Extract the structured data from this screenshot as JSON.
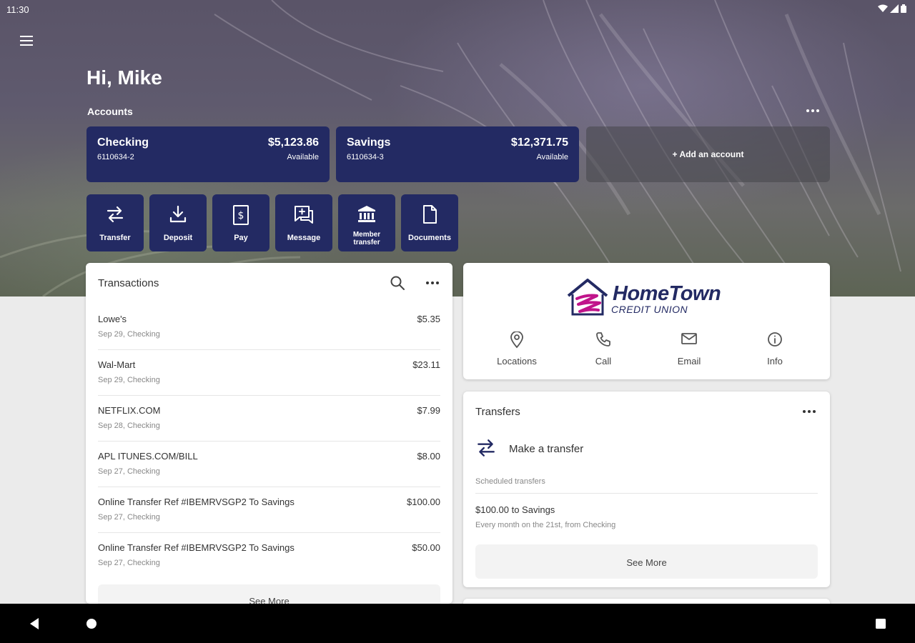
{
  "status_bar": {
    "time": "11:30"
  },
  "greeting": "Hi, Mike",
  "accounts": {
    "label": "Accounts",
    "items": [
      {
        "name": "Checking",
        "number": "6110634-2",
        "balance": "$5,123.86",
        "balance_label": "Available"
      },
      {
        "name": "Savings",
        "number": "6110634-3",
        "balance": "$12,371.75",
        "balance_label": "Available"
      }
    ],
    "add_label": "+ Add an account"
  },
  "actions": [
    {
      "label": "Transfer",
      "icon": "transfer-icon"
    },
    {
      "label": "Deposit",
      "icon": "deposit-icon"
    },
    {
      "label": "Pay",
      "icon": "pay-icon"
    },
    {
      "label": "Message",
      "icon": "message-icon"
    },
    {
      "label_line1": "Member",
      "label_line2": "transfer",
      "icon": "bank-icon"
    },
    {
      "label": "Documents",
      "icon": "document-icon"
    }
  ],
  "transactions": {
    "title": "Transactions",
    "rows": [
      {
        "merchant": "Lowe's",
        "meta": "Sep 29, Checking",
        "amount": "$5.35"
      },
      {
        "merchant": "Wal-Mart",
        "meta": "Sep 29, Checking",
        "amount": "$23.11"
      },
      {
        "merchant": "NETFLIX.COM",
        "meta": "Sep 28, Checking",
        "amount": "$7.99"
      },
      {
        "merchant": "APL ITUNES.COM/BILL",
        "meta": "Sep 27, Checking",
        "amount": "$8.00"
      },
      {
        "merchant": "Online Transfer Ref #IBEMRVSGP2 To Savings",
        "meta": "Sep 27, Checking",
        "amount": "$100.00"
      },
      {
        "merchant": "Online Transfer Ref #IBEMRVSGP2 To Savings",
        "meta": "Sep 27, Checking",
        "amount": "$50.00"
      }
    ],
    "see_more": "See More"
  },
  "credit_union": {
    "brand": "HomeTown",
    "subtitle": "CREDIT UNION",
    "actions": [
      {
        "label": "Locations",
        "icon": "location-pin-icon"
      },
      {
        "label": "Call",
        "icon": "phone-icon"
      },
      {
        "label": "Email",
        "icon": "email-icon"
      },
      {
        "label": "Info",
        "icon": "info-icon"
      }
    ]
  },
  "transfers": {
    "title": "Transfers",
    "make_label": "Make a transfer",
    "scheduled_label": "Scheduled transfers",
    "scheduled": [
      {
        "title": "$100.00 to Savings",
        "subtitle": "Every month on the 21st, from Checking"
      }
    ],
    "see_more": "See More"
  },
  "colors": {
    "accent": "#232a63",
    "brand_magenta": "#c0148a",
    "background": "#ebebeb"
  }
}
